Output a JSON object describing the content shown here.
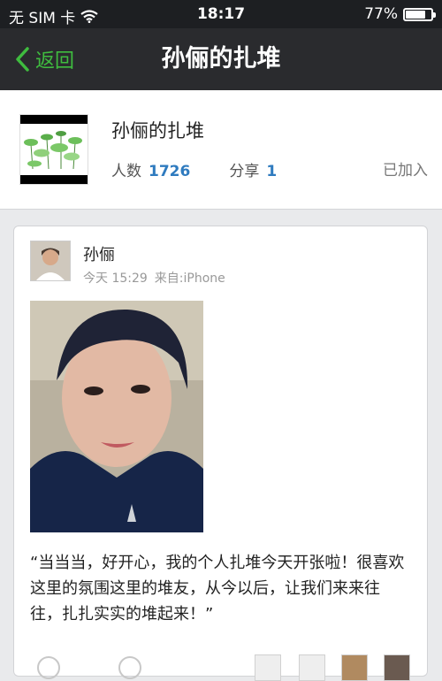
{
  "status_bar": {
    "carrier": "无 SIM 卡",
    "time": "18:17",
    "battery_percent": "77%",
    "battery_level": 0.77
  },
  "nav": {
    "back_label": "返回",
    "title": "孙俪的扎堆"
  },
  "group": {
    "name": "孙俪的扎堆",
    "members_label": "人数",
    "members_count": "1726",
    "share_label": "分享",
    "share_count": "1",
    "joined_label": "已加入"
  },
  "post": {
    "author": "孙俪",
    "time": "今天 15:29",
    "source": "来自:iPhone",
    "text": "“当当当，好开心，我的个人扎堆今天开张啦！很喜欢这里的氛围这里的堆友，从今以后，让我们来来往往，扎扎实实的堆起来！”"
  },
  "colors": {
    "nav_bg": "#2a2b2e",
    "accent_green": "#3fbc3f",
    "count_blue": "#2f7bbf"
  }
}
